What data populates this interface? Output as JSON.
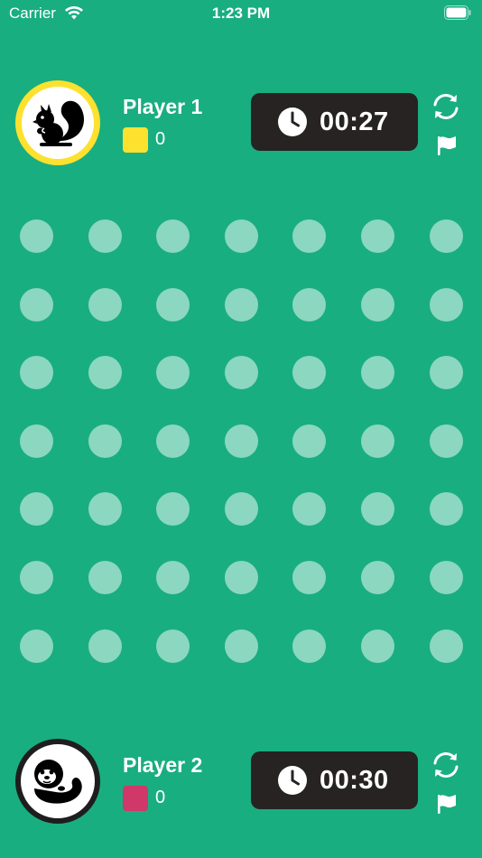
{
  "status_bar": {
    "carrier": "Carrier",
    "time": "1:23 PM",
    "icons": [
      "wifi-icon",
      "battery-icon"
    ]
  },
  "colors": {
    "background": "#19ae80",
    "dot": "#8ad7bf",
    "timer_bg": "#262322",
    "player1_color": "#fde12f",
    "player2_color": "#d0386a"
  },
  "players": [
    {
      "name": "Player 1",
      "score": "0",
      "timer": "00:27",
      "avatar_icon": "squirrel-icon",
      "color": "#fde12f"
    },
    {
      "name": "Player 2",
      "score": "0",
      "timer": "00:30",
      "avatar_icon": "otter-icon",
      "color": "#d0386a"
    }
  ],
  "board": {
    "rows": 7,
    "cols": 7
  }
}
